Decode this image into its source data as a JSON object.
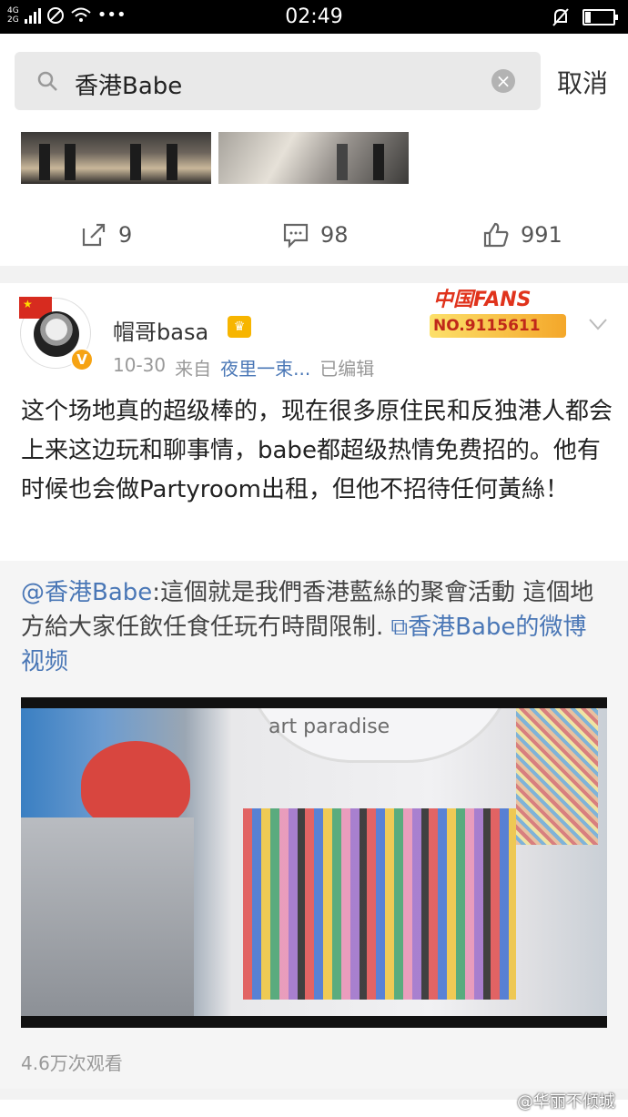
{
  "status_bar": {
    "network": "4G\n2G",
    "time": "02:49",
    "battery_level": 0.2
  },
  "search": {
    "query": "香港Babe",
    "cancel_label": "取消"
  },
  "prev_post": {
    "actions": {
      "repost_count": "9",
      "comment_count": "98",
      "like_count": "991"
    }
  },
  "post": {
    "username": "帽哥basa",
    "fans_badge": {
      "title": "中国FANS",
      "number": "NO.9115611"
    },
    "date": "10-30",
    "from_label": "来自",
    "source": "夜里一束...",
    "edited": "已编辑",
    "text": "这个场地真的超级棒的，现在很多原住民和反独港人都会上来这边玩和聊事情，babe都超级热情免费招的。他有时候也会做Partyroom出租，但他不招待任何黃絲！"
  },
  "repost": {
    "mention": "@香港Babe",
    "text": ":這個就是我們香港藍絲的聚會活動 這個地方給大家任飲任食任玩冇時間限制.",
    "video_link": "香港Babe的微博视频",
    "video_label": "art paradise",
    "views": "4.6万次观看"
  },
  "watermark": "@华丽不倾城",
  "colors": {
    "link": "#4a77b6",
    "verified": "#f6a313",
    "badge_red": "#e0331c"
  }
}
